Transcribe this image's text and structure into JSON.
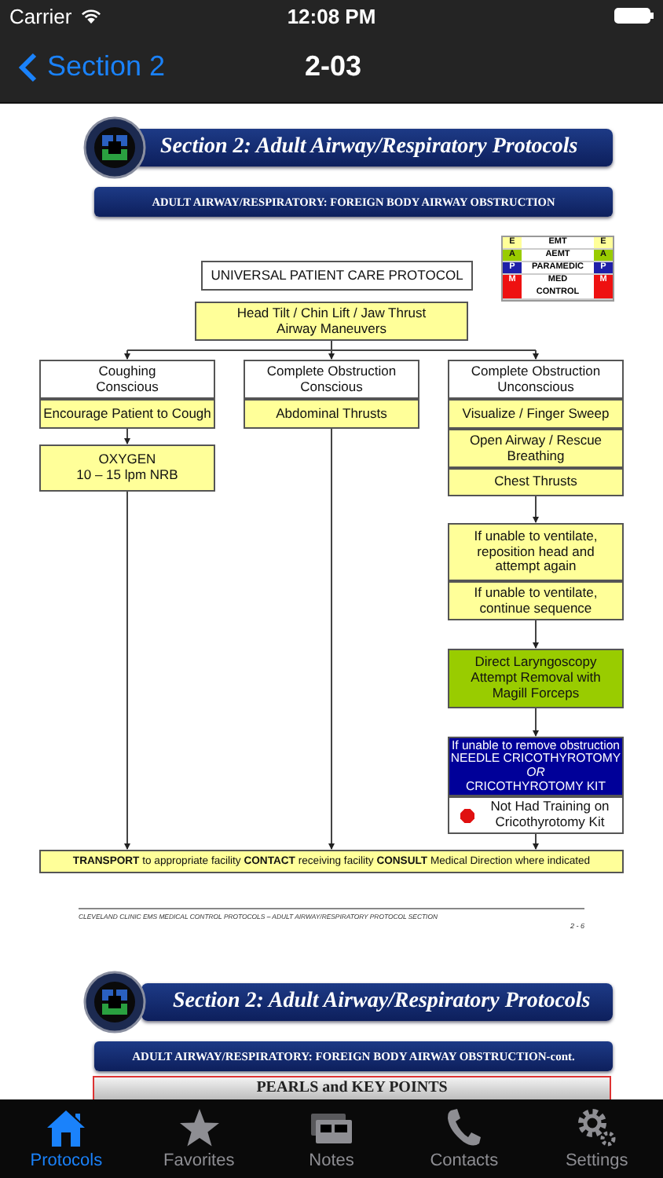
{
  "status_bar": {
    "carrier": "Carrier",
    "time": "12:08 PM"
  },
  "nav": {
    "back": "Section 2",
    "title": "2-03"
  },
  "page1": {
    "banner": "Section 2: Adult Airway/Respiratory Protocols",
    "subtitle": "ADULT AIRWAY/RESPIRATORY: FOREIGN BODY AIRWAY OBSTRUCTION",
    "legend": [
      {
        "letter": "E",
        "label": "EMT",
        "letter_right": "E",
        "color": "#ffff99"
      },
      {
        "letter": "A",
        "label": "AEMT",
        "letter_right": "A",
        "color": "#99cc00"
      },
      {
        "letter": "P",
        "label": "PARAMEDIC",
        "letter_right": "P",
        "color": "#1f1fa8"
      },
      {
        "letter": "M",
        "label": "MED\nCONTROL",
        "letter_right": "M",
        "color": "#ee1111"
      }
    ],
    "nodes": [
      {
        "kind": "white",
        "text": "UNIVERSAL PATIENT CARE PROTOCOL"
      },
      {
        "kind": "yellow",
        "text": "Head Tilt / Chin Lift / Jaw Thrust\nAirway Maneuvers"
      },
      {
        "kind": "white",
        "text": "Coughing\nConscious"
      },
      {
        "kind": "yellow",
        "text": "Encourage Patient to Cough"
      },
      {
        "kind": "yellow",
        "text": "OXYGEN\n10 – 15 lpm NRB"
      },
      {
        "kind": "white",
        "text": "Complete Obstruction\nConscious"
      },
      {
        "kind": "yellow",
        "text": "Abdominal Thrusts"
      },
      {
        "kind": "white",
        "text": "Complete Obstruction\nUnconscious"
      },
      {
        "kind": "yellow",
        "text": "Visualize / Finger Sweep"
      },
      {
        "kind": "yellow",
        "text": "Open Airway / Rescue\nBreathing"
      },
      {
        "kind": "yellow",
        "text": "Chest Thrusts"
      },
      {
        "kind": "yellow",
        "text": "If unable to ventilate,\nreposition head and\nattempt again"
      },
      {
        "kind": "yellow",
        "text": "If unable to ventilate,\ncontinue sequence"
      },
      {
        "kind": "green",
        "text": "Direct Laryngoscopy\nAttempt Removal with\nMagill Forceps"
      },
      {
        "kind": "blue",
        "text": "If unable to remove obstruction\nNEEDLE CRICOTHYROTOMY\n*OR*\nCRICOTHYROTOMY KIT"
      },
      {
        "kind": "stop",
        "text": "Not Had Training on\nCricothyrotomy Kit"
      },
      {
        "kind": "yellow",
        "text": "**TRANSPORT** to appropriate facility **CONTACT** receiving facility **CONSULT** Medical Direction where indicated"
      }
    ],
    "footer": "CLEVELAND CLINIC EMS MEDICAL CONTROL PROTOCOLS – ADULT AIRWAY/RESPIRATORY PROTOCOL SECTION",
    "page_number": "2 - 6"
  },
  "page2": {
    "banner": "Section 2: Adult Airway/Respiratory Protocols",
    "subtitle": "ADULT AIRWAY/RESPIRATORY: FOREIGN BODY AIRWAY OBSTRUCTION-cont.",
    "heading": "PEARLS and KEY POINTS"
  },
  "tabs": [
    {
      "label": "Protocols",
      "selected": true
    },
    {
      "label": "Favorites",
      "selected": false
    },
    {
      "label": "Notes",
      "selected": false
    },
    {
      "label": "Contacts",
      "selected": false
    },
    {
      "label": "Settings",
      "selected": false
    }
  ]
}
